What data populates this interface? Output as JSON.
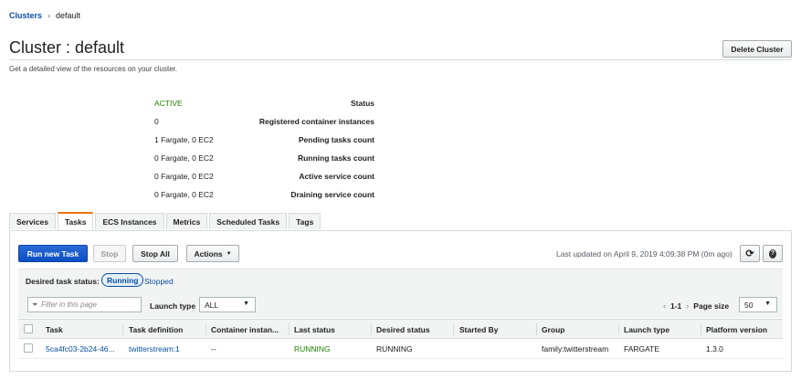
{
  "breadcrumb": {
    "root": "Clusters",
    "separator": "›",
    "current": "default"
  },
  "header": {
    "title": "Cluster : default",
    "subtitle": "Get a detailed view of the resources on your cluster.",
    "delete_label": "Delete Cluster"
  },
  "details": [
    {
      "label": "Status",
      "value": "ACTIVE"
    },
    {
      "label": "Registered container instances",
      "value": "0"
    },
    {
      "label": "Pending tasks count",
      "value": "1 Fargate, 0 EC2"
    },
    {
      "label": "Running tasks count",
      "value": "0 Fargate, 0 EC2"
    },
    {
      "label": "Active service count",
      "value": "0 Fargate, 0 EC2"
    },
    {
      "label": "Draining service count",
      "value": "0 Fargate, 0 EC2"
    }
  ],
  "tabs": [
    "Services",
    "Tasks",
    "ECS Instances",
    "Metrics",
    "Scheduled Tasks",
    "Tags"
  ],
  "active_tab": "Tasks",
  "toolbar": {
    "run_new_task": "Run new Task",
    "stop": "Stop",
    "stop_all": "Stop All",
    "actions": "Actions",
    "last_updated": "Last updated on April 9, 2019 4:09:38 PM (0m ago)",
    "refresh_icon": "refresh-icon",
    "help_icon": "help-icon"
  },
  "status_filter": {
    "label": "Desired task status:",
    "selected": "Running",
    "other": "Stopped"
  },
  "filter": {
    "placeholder": "Filter in this page",
    "launch_type_label": "Launch type",
    "launch_type_value": "ALL",
    "pager_prev": "‹",
    "pager_range": "1-1",
    "pager_next": "›",
    "page_size_label": "Page size",
    "page_size_value": "50"
  },
  "table": {
    "columns": [
      "Task",
      "Task definition",
      "Container instan...",
      "Last status",
      "Desired status",
      "Started By",
      "Group",
      "Launch type",
      "Platform version"
    ],
    "rows": [
      [
        "5ca4fc03-2b24-46...",
        "twitterstream:1",
        "--",
        "RUNNING",
        "RUNNING",
        "",
        "family:twitterstream",
        "FARGATE",
        "1.3.0"
      ]
    ]
  },
  "colors": {
    "accent": "#ec7211",
    "link": "#0a4fa3",
    "status_ok": "#1d8102",
    "primary_button": "#0b4fc4"
  }
}
